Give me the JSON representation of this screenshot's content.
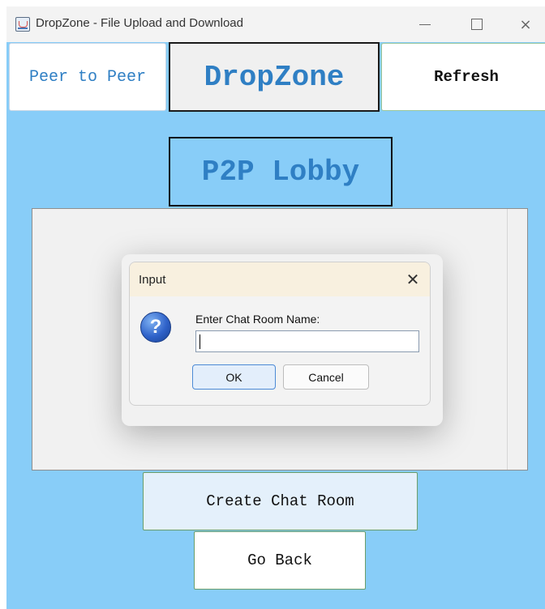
{
  "window": {
    "title": "DropZone - File Upload and Download",
    "icon": "java-app-icon",
    "controls": {
      "minimize": "minimize-icon",
      "maximize": "maximize-icon",
      "close": "×"
    }
  },
  "header": {
    "peer_label": "Peer to Peer",
    "logo_text": "DropZone",
    "refresh_label": "Refresh"
  },
  "lobby": {
    "title": "P2P Lobby"
  },
  "dialog": {
    "title": "Input",
    "close": "✕",
    "icon": "question-icon",
    "icon_glyph": "?",
    "prompt": "Enter Chat Room Name:",
    "input_value": "",
    "ok_label": "OK",
    "cancel_label": "Cancel"
  },
  "footer": {
    "create_label": "Create Chat Room",
    "back_label": "Go Back"
  },
  "colors": {
    "background": "#88cdf8",
    "accent_text": "#2f7fc4",
    "dialog_titlebar": "#f8f0df"
  }
}
